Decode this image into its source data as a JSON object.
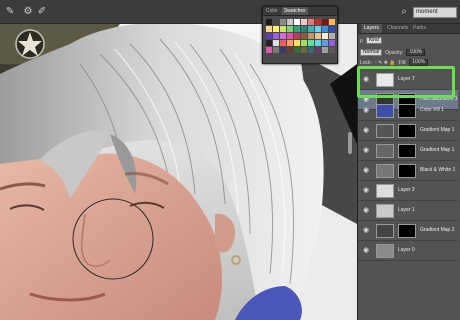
{
  "toolbar": {
    "search_value": "moment",
    "icons": [
      "brush-icon",
      "settings-icon",
      "pen-icon",
      "check-icon"
    ]
  },
  "swatches_panel": {
    "tabs": [
      "Color",
      "Swatches"
    ],
    "active_tab": "Swatches",
    "colors": [
      "#1a1a1a",
      "#4b4b4b",
      "#8c8c8c",
      "#c8c8c8",
      "#ffffff",
      "#f2c9c9",
      "#e07b7b",
      "#c22d2d",
      "#7a1414",
      "#ffb84d",
      "#ffd98a",
      "#fff36b",
      "#c9e86b",
      "#7ed37e",
      "#2ea86b",
      "#2f7f7f",
      "#3fb6b6",
      "#6bd0ef",
      "#3d8fe0",
      "#2f4fb0",
      "#5f3fb0",
      "#9b5fe0",
      "#d36bd8",
      "#e84fa3",
      "#b83d5f",
      "#8a5a3a",
      "#c4946b",
      "#e8c49b",
      "#ffe9cf",
      "#b0b0b0",
      "#222222",
      "#e0e0e0",
      "#ff5b5b",
      "#ff9f5b",
      "#ffe05b",
      "#9fe05b",
      "#5be09f",
      "#5bd8e0",
      "#5b9fe0",
      "#9f5be0",
      "#e05bb0",
      "#7a7a7a",
      "#3a3a6a",
      "#6a3a3a",
      "#3a6a3a",
      "#6a6a3a",
      "#3a6a6a",
      "#6a3a6a",
      "#a0a0a0",
      "#5a5a5a"
    ]
  },
  "layers_panel": {
    "tabs": [
      "Layers",
      "Channels",
      "Paths"
    ],
    "active_tab": "Layers",
    "filter_kind": "Kind",
    "blend_mode": "Normal",
    "opacity_label": "Opacity:",
    "opacity_value": "100%",
    "lock_label": "Lock:",
    "fill_label": "Fill:",
    "fill_value": "100%",
    "layers": [
      {
        "name": "Layer 7",
        "thumb": "#e8e8e8",
        "has_mask": false,
        "selected": false
      },
      {
        "name": "Hue/Saturation 1",
        "thumb": "#333333",
        "has_mask": true,
        "selected": true
      },
      {
        "name": "Color Fill 1",
        "thumb": "#3b4ea8",
        "has_mask": true,
        "selected": false
      },
      {
        "name": "Gradient Map 1",
        "thumb": "#555555",
        "has_mask": true,
        "selected": false
      },
      {
        "name": "Gradient Map 1",
        "thumb": "#666666",
        "has_mask": true,
        "selected": false
      },
      {
        "name": "Black & White 1",
        "thumb": "#777777",
        "has_mask": true,
        "selected": false
      },
      {
        "name": "Layer 2",
        "thumb": "#dcdcdc",
        "has_mask": false,
        "selected": false
      },
      {
        "name": "Layer 1",
        "thumb": "#c9c9c9",
        "has_mask": false,
        "selected": false
      },
      {
        "name": "Gradient Map 2",
        "thumb": "#444444",
        "has_mask": true,
        "selected": false
      },
      {
        "name": "Layer 0",
        "thumb": "#8a8a8a",
        "has_mask": false,
        "selected": false
      }
    ]
  }
}
